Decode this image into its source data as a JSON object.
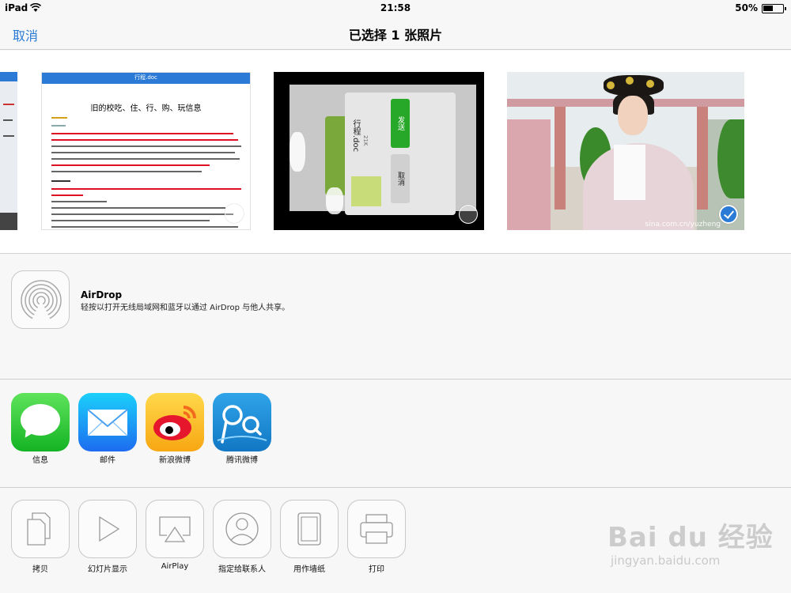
{
  "status_bar": {
    "device": "iPad",
    "time": "21:58",
    "battery": "50%"
  },
  "nav": {
    "cancel": "取消",
    "title": "已选择 1 张照片"
  },
  "photos": {
    "doc_topbar_title": "行程.doc",
    "doc_heading": "旧的校吃、住、行、购、玩信息",
    "chat_file_name": "行程.doc",
    "chat_file_size": "21K",
    "chat_send": "发送",
    "chat_cancel": "取消",
    "watermark": "sina.com.cn/yuzheng",
    "selected_index": 4
  },
  "airdrop": {
    "title": "AirDrop",
    "description": "轻按以打开无线局域网和蓝牙以通过 AirDrop 与他人共享。"
  },
  "share_apps": [
    {
      "label": "信息",
      "icon": "messages-icon"
    },
    {
      "label": "邮件",
      "icon": "mail-icon"
    },
    {
      "label": "新浪微博",
      "icon": "sina-weibo-icon"
    },
    {
      "label": "腾讯微博",
      "icon": "tencent-weibo-icon"
    }
  ],
  "actions": [
    {
      "label": "拷贝",
      "icon": "copy-icon"
    },
    {
      "label": "幻灯片显示",
      "icon": "slideshow-icon"
    },
    {
      "label": "AirPlay",
      "icon": "airplay-icon"
    },
    {
      "label": "指定给联系人",
      "icon": "contact-icon"
    },
    {
      "label": "用作墙纸",
      "icon": "wallpaper-icon"
    },
    {
      "label": "打印",
      "icon": "print-icon"
    }
  ],
  "watermark": {
    "logo": "Bai du 经验",
    "url": "jingyan.baidu.com"
  }
}
